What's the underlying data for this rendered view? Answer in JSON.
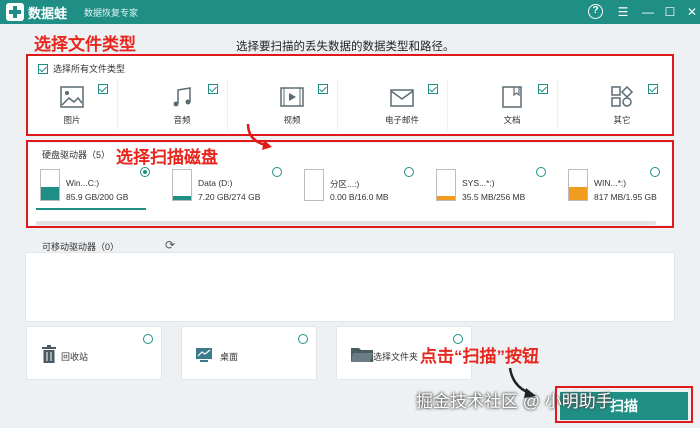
{
  "app": {
    "name": "数据蛙",
    "subtitle": "数据恢复专家"
  },
  "window_controls": {
    "help": "?",
    "menu": "☰",
    "minimize": "—",
    "maximize": "☐",
    "close": "✕"
  },
  "annotations": {
    "select_types": "选择文件类型",
    "select_disk": "选择扫描磁盘",
    "click_scan": "点击“扫描”按钮"
  },
  "hint": "选择要扫描的丢失数据的数据类型和路径。",
  "file_types": {
    "select_all_label": "选择所有文件类型",
    "items": [
      {
        "label": "图片",
        "icon": "image-icon",
        "checked": true
      },
      {
        "label": "音频",
        "icon": "music-icon",
        "checked": true
      },
      {
        "label": "视频",
        "icon": "video-icon",
        "checked": true
      },
      {
        "label": "电子邮件",
        "icon": "email-icon",
        "checked": true
      },
      {
        "label": "文档",
        "icon": "document-icon",
        "checked": true
      },
      {
        "label": "其它",
        "icon": "other-icon",
        "checked": true
      }
    ]
  },
  "hard_drives": {
    "title": "硬盘驱动器（5）",
    "items": [
      {
        "name": "Win...C:)",
        "size": "85.9 GB/200 GB",
        "used": 0.43,
        "color": "#1f8f86",
        "selected": true
      },
      {
        "name": "Data (D:)",
        "size": "7.20 GB/274 GB",
        "used": 0.03,
        "color": "#1f8f86",
        "selected": false
      },
      {
        "name": "分区...:)",
        "size": "0.00  B/16.0 MB",
        "used": 0.0,
        "color": "#f29c1f",
        "selected": false
      },
      {
        "name": "SYS...*:)",
        "size": "35.5 MB/256 MB",
        "used": 0.14,
        "color": "#f29c1f",
        "selected": false
      },
      {
        "name": "WIN...*:)",
        "size": "817 MB/1.95 GB",
        "used": 0.42,
        "color": "#f29c1f",
        "selected": false
      }
    ]
  },
  "removable": {
    "title": "可移动驱动器（0）"
  },
  "locations": [
    {
      "label": "回收站",
      "icon": "recycle-bin-icon"
    },
    {
      "label": "桌面",
      "icon": "desktop-icon"
    },
    {
      "label": "选择文件夹",
      "icon": "folder-icon"
    }
  ],
  "scan_button": "扫描",
  "watermark": "掘金技术社区 @ 小明助手",
  "colors": {
    "accent": "#1f8f86",
    "annotation": "#e8261d",
    "warning_fill": "#f29c1f"
  }
}
